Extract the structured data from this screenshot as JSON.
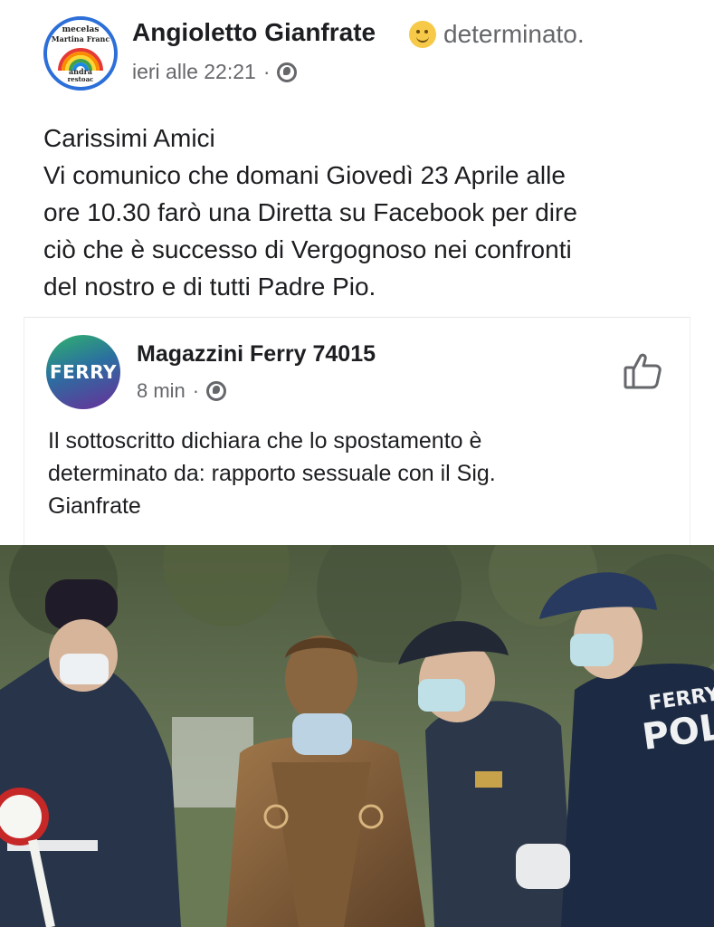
{
  "post": {
    "author": "Angioletto Gianfrate",
    "feeling": "determinato.",
    "timestamp": "ieri alle 22:21",
    "separator": "·",
    "body_lines": [
      "Carissimi Amici",
      "Vi comunico che domani Giovedì 23 Aprile alle",
      "ore 10.30 farò una Diretta su Facebook per dire",
      "ciò che è successo di Vergognoso nei confronti",
      "del nostro e di tutti Padre Pio."
    ]
  },
  "avatar_main": {
    "line1": "mecelas",
    "line2": "Martina Franc",
    "line3": "andra",
    "line4": "restoac"
  },
  "shared": {
    "avatar_text": "FERRY",
    "name": "Magazzini Ferry 74015",
    "time": "8 min",
    "separator": "·",
    "text_lines": [
      "Il sottoscritto dichiara che lo spostamento è",
      "determinato da: rapporto sessuale con il Sig.",
      "Gianfrate"
    ]
  },
  "photo": {
    "jacket_text_1": "FERRY",
    "jacket_text_2": "POLIZ"
  },
  "colors": {
    "text": "#1c1e21",
    "secondary": "#65676b",
    "avatar_border": "#2c6fd8"
  },
  "icons": {
    "feeling": "slightly-smiling-emoji-icon",
    "privacy": "globe-icon",
    "like": "thumbs-up-icon"
  }
}
